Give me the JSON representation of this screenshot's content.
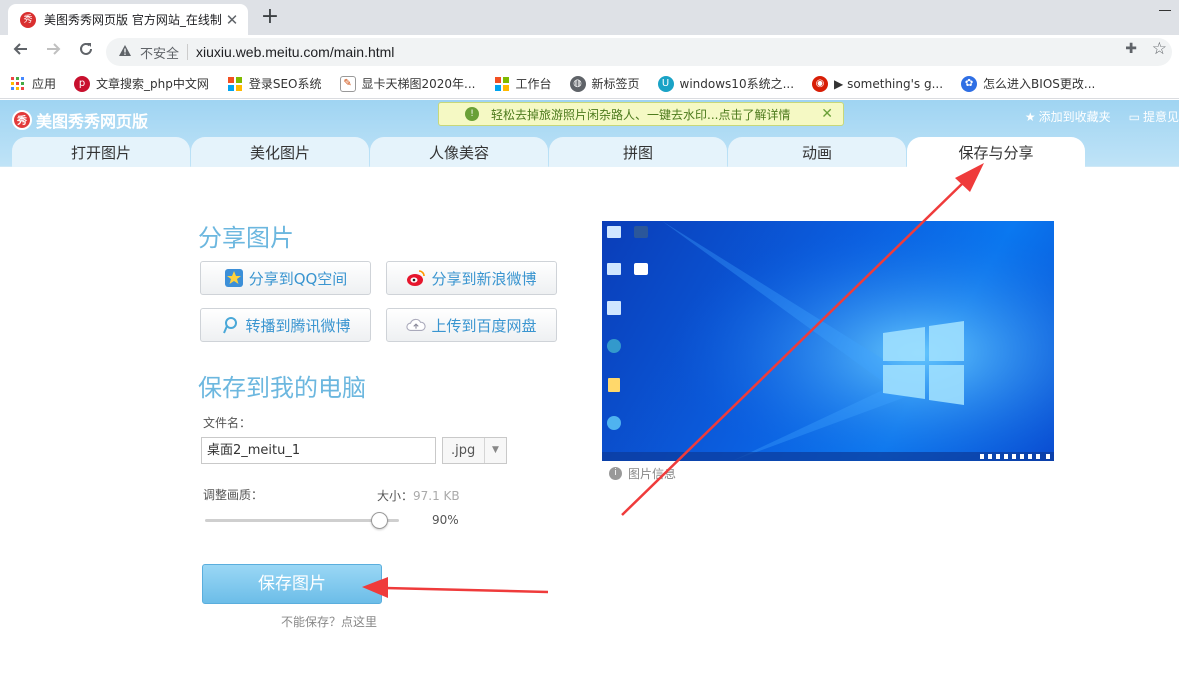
{
  "browser": {
    "tab_title": "美图秀秀网页版 官方网站_在线制",
    "favicon_text": "秀",
    "close_glyph": "✕",
    "newtab_glyph": "+",
    "insecure_label": "不安全",
    "url": "xiuxiu.web.meitu.com/main.html",
    "bookmarks": [
      {
        "label": "应用",
        "icon": "apps-grid-icon"
      },
      {
        "label": "文章搜索_php中文网",
        "icon": "php-icon"
      },
      {
        "label": "登录SEO系统",
        "icon": "windows-logo-icon"
      },
      {
        "label": "显卡天梯图2020年...",
        "icon": "gpu-chart-icon"
      },
      {
        "label": "工作台",
        "icon": "windows-logo-icon"
      },
      {
        "label": "新标签页",
        "icon": "globe-icon"
      },
      {
        "label": "windows10系统之...",
        "icon": "site-u-icon"
      },
      {
        "label": "▶ something's g...",
        "icon": "netease-music-icon"
      },
      {
        "label": "怎么进入BIOS更改...",
        "icon": "baidu-paw-icon"
      }
    ]
  },
  "app": {
    "brand": "美图秀秀网页版",
    "promo_text": "轻松去掉旅游照片闲杂路人、一键去水印...点击了解详情",
    "header_links": {
      "favorite": "添加到收藏夹",
      "feedback": "提意见"
    },
    "tabs": [
      {
        "label": "打开图片",
        "active": false
      },
      {
        "label": "美化图片",
        "active": false
      },
      {
        "label": "人像美容",
        "active": false
      },
      {
        "label": "拼图",
        "active": false
      },
      {
        "label": "动画",
        "active": false
      },
      {
        "label": "保存与分享",
        "active": true
      }
    ]
  },
  "share": {
    "title": "分享图片",
    "buttons": {
      "qzone": "分享到QQ空间",
      "weibo": "分享到新浪微博",
      "tencent_weibo": "转播到腾讯微博",
      "baidu_pan": "上传到百度网盘"
    }
  },
  "save": {
    "title": "保存到我的电脑",
    "filename_label": "文件名：",
    "filename_value": "桌面2_meitu_1",
    "format_value": ".jpg",
    "quality_label": "调整画质：",
    "size_label": "大小：",
    "size_value": "97.1 KB",
    "quality_value": "90%",
    "quality_fraction": 0.9,
    "save_button": "保存图片",
    "cant_save_link": "不能保存？点这里"
  },
  "preview": {
    "info_label": "图片信息",
    "desktop_icons": [
      "此电脑",
      "Word",
      "网络",
      "百度网盘",
      "回收站",
      "Edge",
      "文档",
      "Edge"
    ]
  },
  "colors": {
    "accent": "#6cb7df",
    "annotation_arrow": "#ef3b3b"
  }
}
